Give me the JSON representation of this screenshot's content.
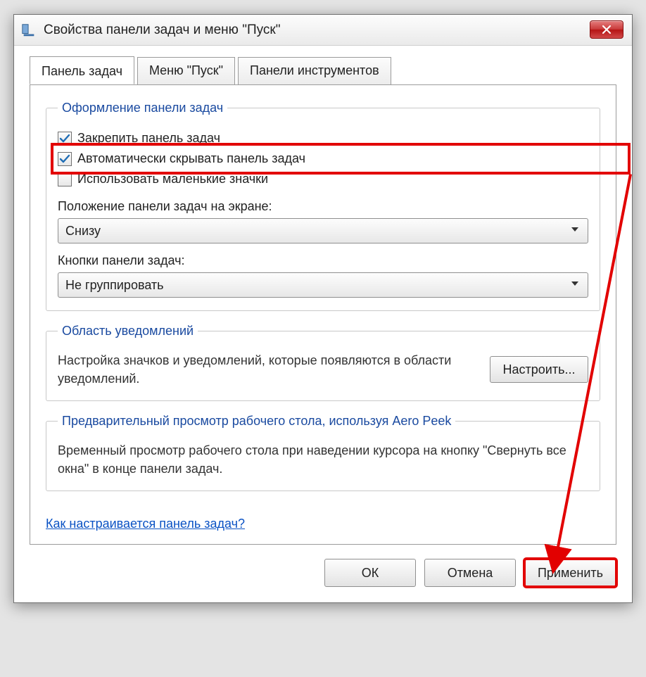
{
  "window": {
    "title": "Свойства панели задач и меню \"Пуск\""
  },
  "tabs": {
    "taskbar": "Панель задач",
    "startmenu": "Меню \"Пуск\"",
    "toolbars": "Панели инструментов"
  },
  "appearance": {
    "legend": "Оформление панели задач",
    "lock": "Закрепить панель задач",
    "autohide": "Автоматически скрывать панель задач",
    "smallicons": "Использовать маленькие значки",
    "position_label": "Положение панели задач на экране:",
    "position_value": "Снизу",
    "buttons_label": "Кнопки панели задач:",
    "buttons_value": "Не группировать"
  },
  "notification": {
    "legend": "Область уведомлений",
    "desc": "Настройка значков и уведомлений, которые появляются в области уведомлений.",
    "button": "Настроить..."
  },
  "aero": {
    "legend": "Предварительный просмотр рабочего стола, используя Aero Peek",
    "desc": "Временный просмотр рабочего стола при наведении курсора на кнопку \"Свернуть все окна\" в конце панели задач."
  },
  "helplink": "Как настраивается панель задач?",
  "buttons": {
    "ok": "ОК",
    "cancel": "Отмена",
    "apply": "Применить"
  }
}
